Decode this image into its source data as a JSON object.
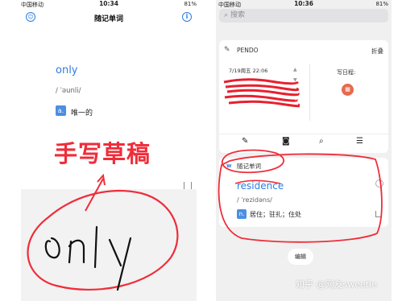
{
  "left_phone": {
    "status": {
      "carrier": "中国移动",
      "time": "10:34",
      "battery": "81%"
    },
    "nav": {
      "title": "随记单词",
      "left_icon": "smiley-icon",
      "right_icon": "info-icon"
    },
    "entry": {
      "word": "only",
      "phonetic": "/ ˈəunli/",
      "pos": "a.",
      "meaning": "唯一的"
    },
    "annotation": "手写草稿",
    "handwriting": "only"
  },
  "right_phone": {
    "status": {
      "carrier": "中国移动",
      "time": "10:36",
      "battery": "81%"
    },
    "search_placeholder": "搜索",
    "pendo": {
      "app_name": "PENDO",
      "fold_label": "折叠",
      "date": "7/19周五  22:06",
      "schedule_label": "写日程:"
    },
    "widget": {
      "badge": "w",
      "title": "随记单词",
      "word": "residence",
      "phonetic": "/ ˈrezidəns/",
      "pos": "n.",
      "meaning": "居住；驻扎；住处"
    },
    "edit_label": "编辑"
  },
  "watermark": "知乎 @网友sweetie",
  "colors": {
    "accent": "#2f7de1",
    "annotation_red": "#ef2d3a"
  }
}
